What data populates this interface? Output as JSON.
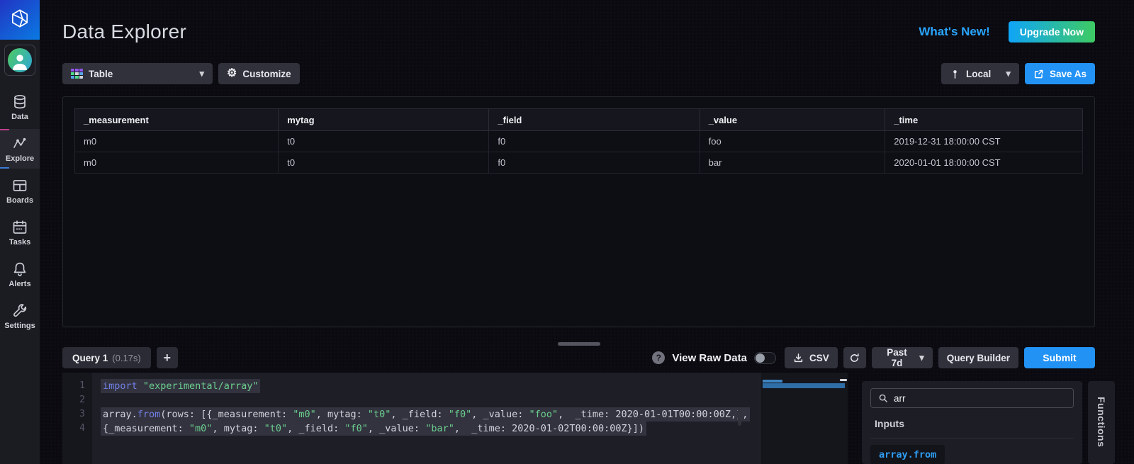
{
  "app": {
    "title": "Data Explorer"
  },
  "header": {
    "whats_new_label": "What's New!",
    "upgrade_label": "Upgrade Now"
  },
  "sidebar": {
    "items": [
      {
        "id": "data",
        "label": "Data",
        "icon": "database-icon",
        "active": false
      },
      {
        "id": "explore",
        "label": "Explore",
        "icon": "pulse-graph-icon",
        "active": true
      },
      {
        "id": "boards",
        "label": "Boards",
        "icon": "dashboard-grid-icon",
        "active": false
      },
      {
        "id": "tasks",
        "label": "Tasks",
        "icon": "calendar-icon",
        "active": false
      },
      {
        "id": "alerts",
        "label": "Alerts",
        "icon": "bell-icon",
        "active": false
      },
      {
        "id": "settings",
        "label": "Settings",
        "icon": "wrench-icon",
        "active": false
      }
    ]
  },
  "toolbar": {
    "view_type_label": "Table",
    "customize_label": "Customize",
    "location_label": "Local",
    "save_as_label": "Save As"
  },
  "results_table": {
    "columns": [
      "_measurement",
      "mytag",
      "_field",
      "_value",
      "_time"
    ],
    "rows": [
      [
        "m0",
        "t0",
        "f0",
        "foo",
        "2019-12-31 18:00:00 CST"
      ],
      [
        "m0",
        "t0",
        "f0",
        "bar",
        "2020-01-01 18:00:00 CST"
      ]
    ]
  },
  "query_bar": {
    "tab_label": "Query 1",
    "tab_duration": "(0.17s)",
    "add_tab_label": "+",
    "help_glyph": "?",
    "view_raw_label": "View Raw Data",
    "view_raw_enabled": false,
    "csv_label": "CSV",
    "time_range_label": "Past 7d",
    "query_builder_label": "Query Builder",
    "submit_label": "Submit"
  },
  "editor": {
    "lines": [
      {
        "num": "1",
        "selected": true,
        "tokens": [
          {
            "t": "import",
            "c": "k"
          },
          {
            "t": " ",
            "c": "d"
          },
          {
            "t": "\"experimental/array\"",
            "c": "s"
          }
        ]
      },
      {
        "num": "2",
        "selected": true,
        "tokens": []
      },
      {
        "num": "3",
        "selected": true,
        "tokens": [
          {
            "t": "array.",
            "c": "d"
          },
          {
            "t": "from",
            "c": "k"
          },
          {
            "t": "(rows: [{_measurement: ",
            "c": "d"
          },
          {
            "t": "\"m0\"",
            "c": "s"
          },
          {
            "t": ", mytag: ",
            "c": "d"
          },
          {
            "t": "\"t0\"",
            "c": "s"
          },
          {
            "t": ", _field: ",
            "c": "d"
          },
          {
            "t": "\"f0\"",
            "c": "s"
          },
          {
            "t": ", _value: ",
            "c": "d"
          },
          {
            "t": "\"foo\"",
            "c": "s"
          },
          {
            "t": ",  _time: 2020-01-01T00:00:00Z,},",
            "c": "d"
          }
        ]
      },
      {
        "num": "4",
        "selected": true,
        "tokens": [
          {
            "t": "{_measurement: ",
            "c": "d"
          },
          {
            "t": "\"m0\"",
            "c": "s"
          },
          {
            "t": ", mytag: ",
            "c": "d"
          },
          {
            "t": "\"t0\"",
            "c": "s"
          },
          {
            "t": ", _field: ",
            "c": "d"
          },
          {
            "t": "\"f0\"",
            "c": "s"
          },
          {
            "t": ", _value: ",
            "c": "d"
          },
          {
            "t": "\"bar\"",
            "c": "s"
          },
          {
            "t": ",  _time: 2020-01-02T00:00:00Z}])",
            "c": "d"
          }
        ]
      }
    ]
  },
  "functions_panel": {
    "search_value": "arr",
    "section_label": "Inputs",
    "function_name": "array.from",
    "tab_label": "Functions"
  },
  "colors": {
    "accent_blue": "#2292f5",
    "upgrade_gradient_start": "#0fa4f8",
    "upgrade_gradient_end": "#3ecb63",
    "whats_new_blue": "#2aa5ff",
    "string_green": "#6bcf8e",
    "keyword_violet": "#7280e8",
    "function_cyan": "#2f9ff4"
  }
}
